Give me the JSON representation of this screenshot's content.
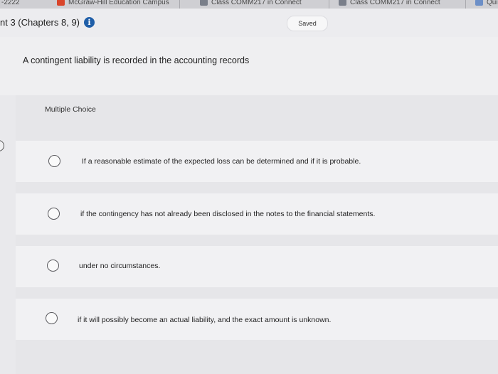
{
  "browser": {
    "tabs": [
      {
        "label": "-2222"
      },
      {
        "label": "McGraw-Hill Education Campus",
        "icon": "mcgraw-hill-icon",
        "color": "#d9452b"
      },
      {
        "label": "Class COMM217 in Connect",
        "icon": "connect-icon",
        "color": "#7a7f8a"
      },
      {
        "label": "Class COMM217 in Connect",
        "icon": "connect-icon",
        "color": "#7a7f8a"
      },
      {
        "label": "Qui",
        "icon": "quiz-icon",
        "color": "#6c8fc7"
      }
    ]
  },
  "header": {
    "assignment_title": "nt 3 (Chapters 8, 9)",
    "info_glyph": "i",
    "saved_label": "Saved"
  },
  "question": {
    "prompt": "A contingent liability is recorded in the accounting records",
    "type_label": "Multiple Choice",
    "choices": [
      {
        "text": "If a reasonable estimate of the expected loss can be determined and if it is probable."
      },
      {
        "text": "if the contingency has not already been disclosed in the notes to the financial statements."
      },
      {
        "text": "under no circumstances."
      },
      {
        "text": "if it will possibly become an actual liability, and the exact amount is unknown."
      }
    ]
  },
  "colors": {
    "info_icon": "#1f5ea8",
    "page_bg": "#e9e9ec",
    "choice_bg": "#f1f1f3"
  }
}
